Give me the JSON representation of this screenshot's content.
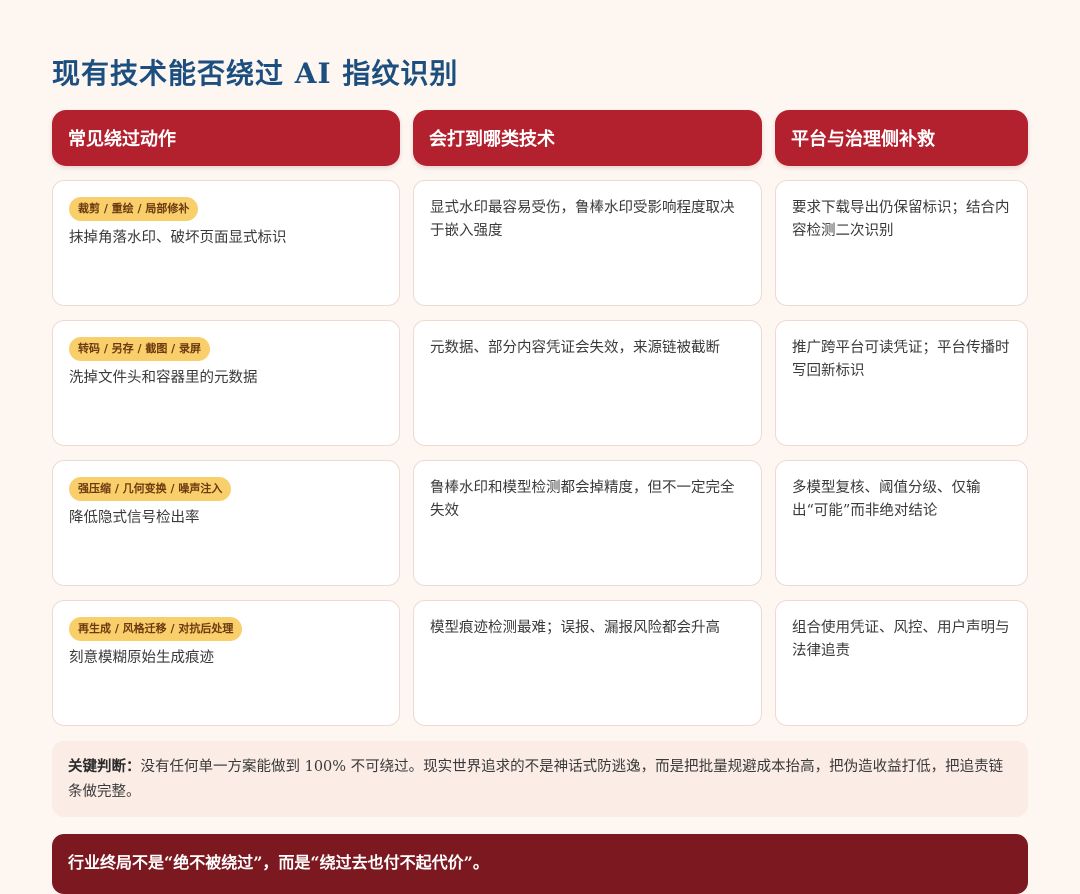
{
  "title": "现有技术能否绕过 AI 指纹识别",
  "columns": [
    "常见绕过动作",
    "会打到哪类技术",
    "平台与治理侧补救"
  ],
  "rows": [
    {
      "tag": "裁剪 / 重绘 / 局部修补",
      "action": "抹掉角落水印、破坏页面显式标识",
      "impact": "显式水印最容易受伤，鲁棒水印受影响程度取决于嵌入强度",
      "remedy": "要求下载导出仍保留标识；结合内容检测二次识别"
    },
    {
      "tag": "转码 / 另存 / 截图 / 录屏",
      "action": "洗掉文件头和容器里的元数据",
      "impact": "元数据、部分内容凭证会失效，来源链被截断",
      "remedy": "推广跨平台可读凭证；平台传播时写回新标识"
    },
    {
      "tag": "强压缩 / 几何变换 / 噪声注入",
      "action": "降低隐式信号检出率",
      "impact": "鲁棒水印和模型检测都会掉精度，但不一定完全失效",
      "remedy": "多模型复核、阈值分级、仅输出“可能”而非绝对结论"
    },
    {
      "tag": "再生成 / 风格迁移 / 对抗后处理",
      "action": "刻意模糊原始生成痕迹",
      "impact": "模型痕迹检测最难；误报、漏报风险都会升高",
      "remedy": "组合使用凭证、风控、用户声明与法律追责"
    }
  ],
  "note": {
    "label": "关键判断：",
    "text": "没有任何单一方案能做到 100% 不可绕过。现实世界追求的不是神话式防逃逸，而是把批量规避成本抬高，把伪造收益打低，把追责链条做完整。"
  },
  "conclusion": "行业终局不是“绝不被绕过”，而是“绕过去也付不起代价”。"
}
